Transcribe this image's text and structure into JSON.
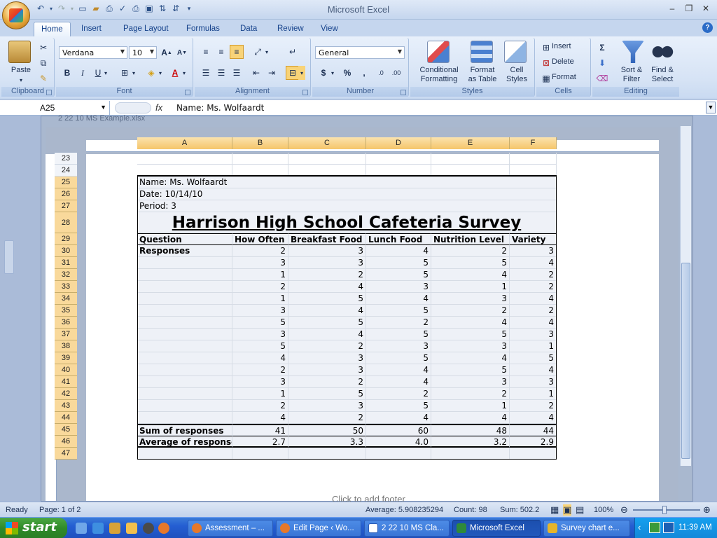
{
  "app": {
    "title": "Microsoft Excel",
    "doc_title": "2 22 10 MS Example.xlsx"
  },
  "ribbon": {
    "tabs": [
      "Home",
      "Insert",
      "Page Layout",
      "Formulas",
      "Data",
      "Review",
      "View"
    ],
    "clipboard": {
      "label": "Clipboard",
      "paste": "Paste"
    },
    "font": {
      "label": "Font",
      "name": "Verdana",
      "size": "10"
    },
    "alignment": {
      "label": "Alignment"
    },
    "number": {
      "label": "Number",
      "format": "General"
    },
    "styles": {
      "label": "Styles",
      "conditional": [
        "Conditional",
        "Formatting"
      ],
      "format_table": [
        "Format",
        "as Table"
      ],
      "cell_styles": [
        "Cell",
        "Styles"
      ]
    },
    "cells": {
      "label": "Cells",
      "insert": "Insert",
      "delete": "Delete",
      "format": "Format"
    },
    "editing": {
      "label": "Editing",
      "sort": [
        "Sort &",
        "Filter"
      ],
      "find": [
        "Find &",
        "Select"
      ]
    }
  },
  "formula_bar": {
    "name_box": "A25",
    "fx": "fx",
    "content": "Name: Ms. Wolfaardt"
  },
  "sheet": {
    "columns": [
      "A",
      "B",
      "C",
      "D",
      "E",
      "F"
    ],
    "rows": [
      "23",
      "24",
      "25",
      "26",
      "27",
      "28",
      "29",
      "30",
      "31",
      "32",
      "33",
      "34",
      "35",
      "36",
      "37",
      "38",
      "39",
      "40",
      "41",
      "42",
      "43",
      "44",
      "45",
      "46",
      "47"
    ],
    "name": "Name: Ms. Wolfaardt",
    "date": "Date: 10/14/10",
    "period": "Period:  3",
    "title": "Harrison High School Cafeteria Survey",
    "headers": [
      "Question",
      "How Often",
      "Breakfast Food",
      "Lunch Food",
      "Nutrition Level",
      "Variety"
    ],
    "responses_label": "Responses",
    "responses": [
      [
        "2",
        "3",
        "4",
        "2",
        "3"
      ],
      [
        "3",
        "3",
        "5",
        "5",
        "4"
      ],
      [
        "1",
        "2",
        "5",
        "4",
        "2"
      ],
      [
        "2",
        "4",
        "3",
        "1",
        "2"
      ],
      [
        "1",
        "5",
        "4",
        "3",
        "4"
      ],
      [
        "3",
        "4",
        "5",
        "2",
        "2"
      ],
      [
        "5",
        "5",
        "2",
        "4",
        "4"
      ],
      [
        "3",
        "4",
        "5",
        "5",
        "3"
      ],
      [
        "5",
        "2",
        "3",
        "3",
        "1"
      ],
      [
        "4",
        "3",
        "5",
        "4",
        "5"
      ],
      [
        "2",
        "3",
        "4",
        "5",
        "4"
      ],
      [
        "3",
        "2",
        "4",
        "3",
        "3"
      ],
      [
        "1",
        "5",
        "2",
        "2",
        "1"
      ],
      [
        "2",
        "3",
        "5",
        "1",
        "2"
      ],
      [
        "4",
        "2",
        "4",
        "4",
        "4"
      ]
    ],
    "sum_label": "Sum of responses",
    "sums": [
      "41",
      "50",
      "60",
      "48",
      "44"
    ],
    "avg_label": "Average of responses",
    "avgs": [
      "2.7",
      "3.3",
      "4.0",
      "3.2",
      "2.9"
    ],
    "footer_hint": "Click to add footer"
  },
  "status": {
    "ready": "Ready",
    "page": "Page: 1 of 2",
    "average": "Average: 5.908235294",
    "count": "Count: 98",
    "sum": "Sum: 502.2",
    "zoom": "100%"
  },
  "taskbar": {
    "start": "start",
    "items": [
      "Assessment – ...",
      "Edit Page ‹ Wo...",
      "2 22 10 MS Cla...",
      "Microsoft Excel",
      "Survey chart e..."
    ],
    "time": "11:39 AM"
  }
}
